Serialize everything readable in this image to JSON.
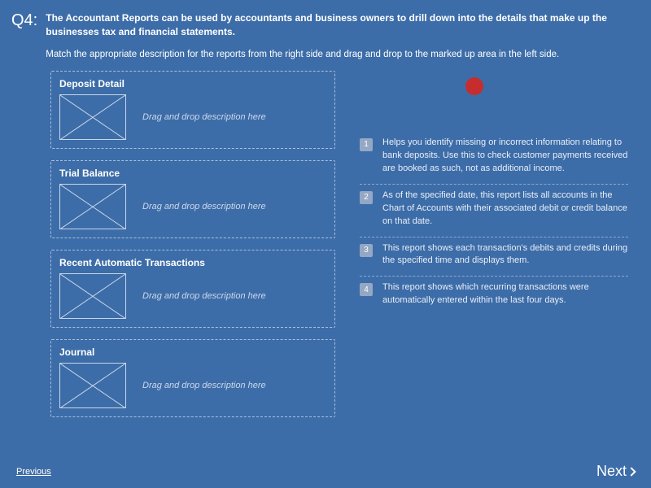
{
  "question_number": "Q4:",
  "title": "The Accountant Reports can be used by accountants and business owners to drill down into the details that make up the businesses tax and financial statements.",
  "instructions": "Match the appropriate description for the reports from the right side and drag and drop to the marked up area in the left side.",
  "drop_hint": "Drag and drop description here",
  "drop_targets": [
    {
      "label": "Deposit Detail"
    },
    {
      "label": "Trial Balance"
    },
    {
      "label": "Recent Automatic Transactions"
    },
    {
      "label": "Journal"
    }
  ],
  "answers": [
    {
      "num": "1",
      "text": "Helps you identify missing or incorrect information relating to bank deposits. Use this to check customer payments received are booked as such, not as additional income."
    },
    {
      "num": "2",
      "text": "As of the specified date, this report lists all accounts in the Chart of Accounts with their associated debit or credit balance on that date."
    },
    {
      "num": "3",
      "text": "This report shows each transaction's debits and credits during the specified time and displays them."
    },
    {
      "num": "4",
      "text": "This report shows which recurring transactions were automatically entered within the last four days."
    }
  ],
  "nav": {
    "previous": "Previous",
    "next": "Next"
  }
}
